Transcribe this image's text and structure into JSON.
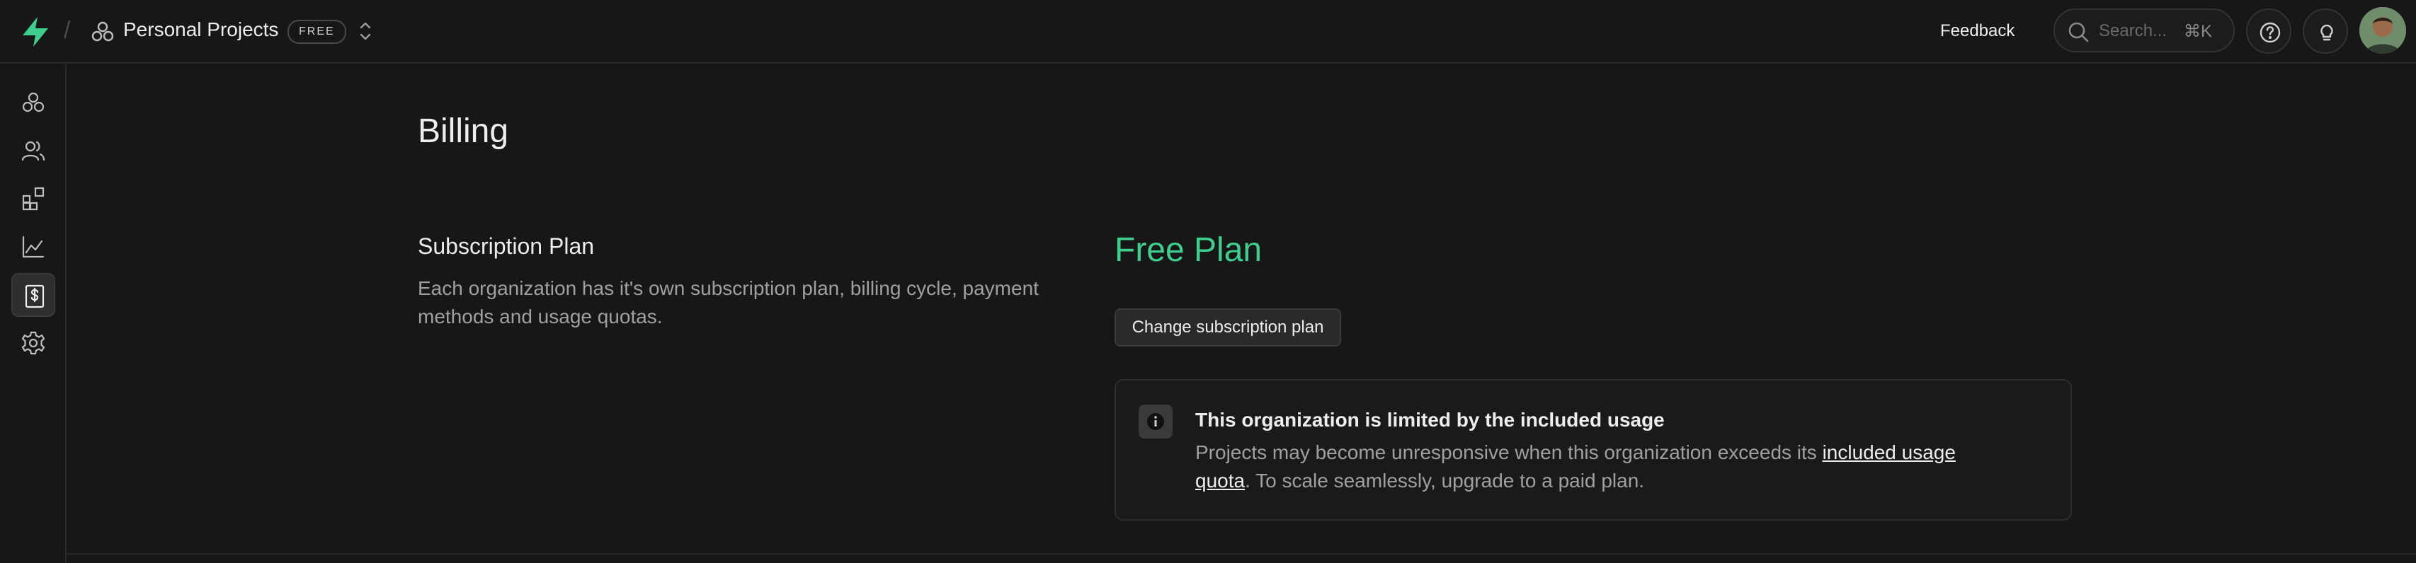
{
  "header": {
    "org_name": "Personal Projects",
    "plan_badge": "FREE",
    "feedback_label": "Feedback",
    "search": {
      "placeholder": "Search...",
      "shortcut": "⌘K"
    }
  },
  "sidebar": {
    "items": [
      {
        "icon": "projects-icon"
      },
      {
        "icon": "team-icon"
      },
      {
        "icon": "integrations-icon"
      },
      {
        "icon": "usage-icon"
      },
      {
        "icon": "billing-icon",
        "active": true
      },
      {
        "icon": "settings-icon"
      }
    ]
  },
  "page": {
    "title": "Billing",
    "subscription": {
      "title": "Subscription Plan",
      "description": "Each organization has it's own subscription plan, billing cycle, payment methods and usage quotas.",
      "plan_name": "Free Plan",
      "change_button": "Change subscription plan"
    },
    "notice": {
      "title": "This organization is limited by the included usage",
      "body_before": "Projects may become unresponsive when this organization exceeds its ",
      "link": "included usage quota",
      "body_after": ". To scale seamlessly, upgrade to a paid plan."
    }
  },
  "colors": {
    "background": "#171717",
    "accent": "#3ecf8e",
    "border": "#2a2a2a"
  }
}
